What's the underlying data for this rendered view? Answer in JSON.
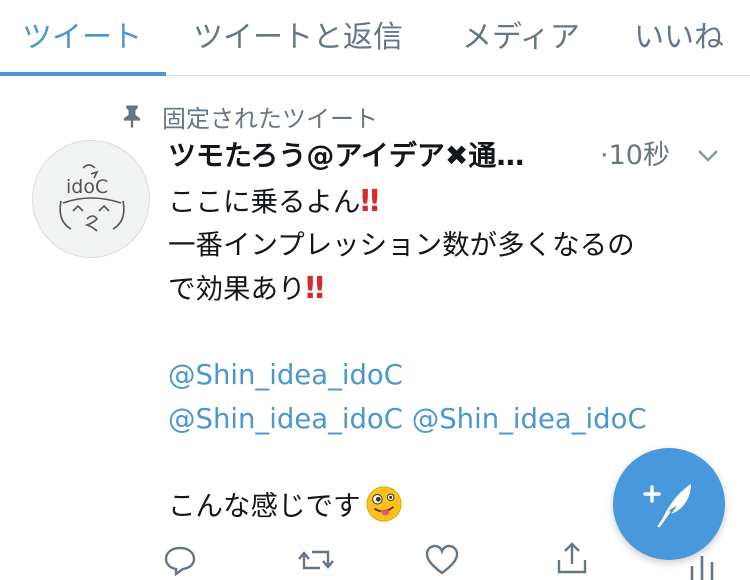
{
  "tabs": [
    {
      "label": "ツイート",
      "active": true
    },
    {
      "label": "ツイートと返信",
      "active": false
    },
    {
      "label": "メディア",
      "active": false
    },
    {
      "label": "いいね",
      "active": false
    }
  ],
  "pinned": {
    "label": "固定されたツイート",
    "icon": "pin-icon"
  },
  "tweet": {
    "display_name": "ツモたろう@アイデア✖︎通…",
    "time": "·10秒",
    "avatar_text": "idoC",
    "line1": "ここに乗るよん",
    "line2": "一番インプレッション数が多くなるの",
    "line3": "で効果あり",
    "bang": "‼",
    "mention": "@Shin_idea_idoC",
    "closing": "こんな感じです",
    "emoji": "zany-face"
  },
  "actions": [
    "reply-icon",
    "retweet-icon",
    "like-icon",
    "share-icon",
    "analytics-icon"
  ],
  "compose": {
    "icon": "compose-icon"
  },
  "colors": {
    "accent": "#4a98cf",
    "muted": "#657786",
    "text": "#14171a",
    "fab": "#4a98dc"
  }
}
